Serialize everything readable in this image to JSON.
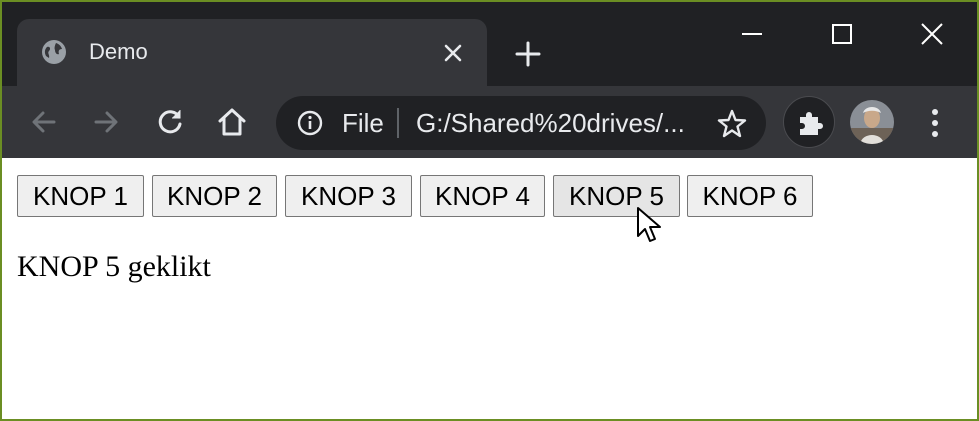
{
  "browser": {
    "tab": {
      "title": "Demo",
      "favicon": "globe-icon",
      "close_icon": "close-icon"
    },
    "new_tab_icon": "plus-icon",
    "window_controls": [
      "minimize-icon",
      "maximize-icon",
      "close-icon"
    ],
    "toolbar": {
      "nav_icons": [
        "back-arrow-icon",
        "forward-arrow-icon",
        "reload-icon",
        "home-icon"
      ],
      "omnibox": {
        "info_icon": "info-icon",
        "scheme": "File",
        "url": "G:/Shared%20drives/...",
        "bookmark_icon": "star-icon"
      },
      "extensions_icon": "puzzle-icon",
      "menu_icon": "kebab-menu-icon"
    }
  },
  "page": {
    "buttons": [
      {
        "label": "KNOP 1"
      },
      {
        "label": "KNOP 2"
      },
      {
        "label": "KNOP 3"
      },
      {
        "label": "KNOP 4"
      },
      {
        "label": "KNOP 5"
      },
      {
        "label": "KNOP 6"
      }
    ],
    "status_text": "KNOP 5 geklikt"
  },
  "colors": {
    "tabstrip": "#202124",
    "toolbar": "#35363a",
    "text_light": "#e8eaed",
    "frame_border": "#6b8e23",
    "button_bg": "#efefef"
  }
}
